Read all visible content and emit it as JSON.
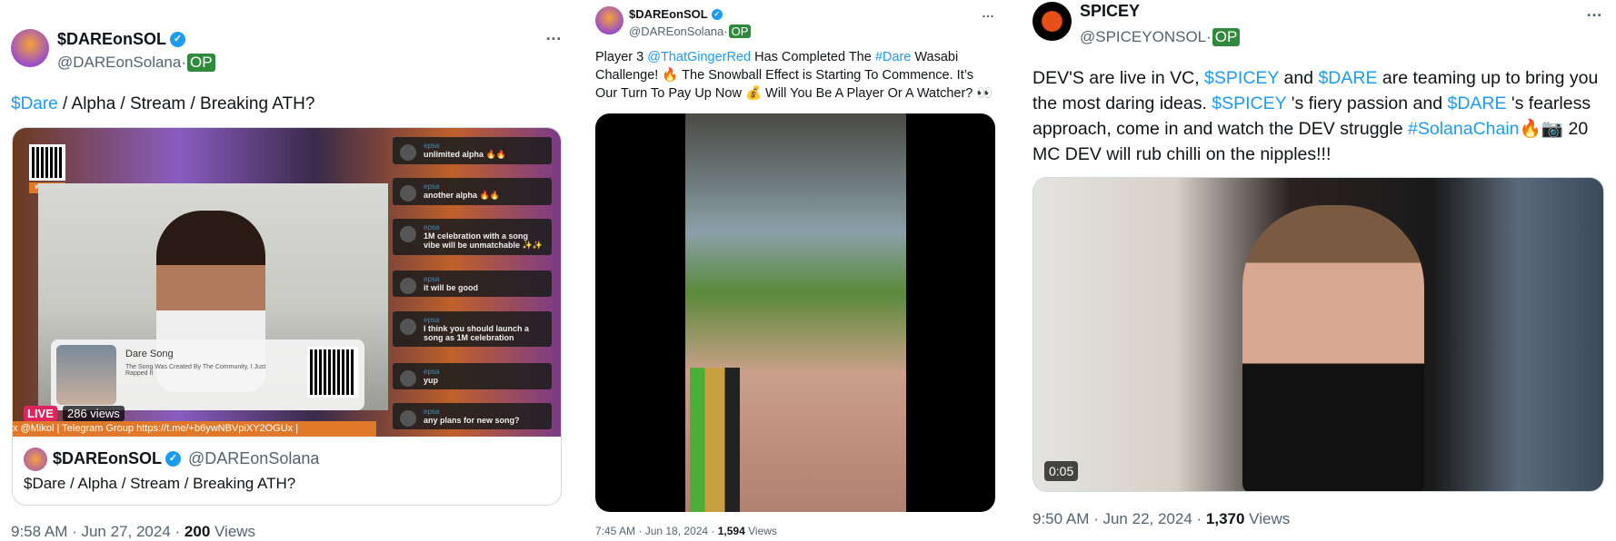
{
  "tweets": [
    {
      "name": "$DAREonSOL",
      "handle": "@DAREonSolana·",
      "op_badge": "OP",
      "text_parts": [
        "$Dare",
        " / Alpha / Stream / Breaking ATH?"
      ],
      "media": {
        "live_badge": "LIVE",
        "views_overlay": "286 views",
        "ticker": "x @Mikol | Telegram Group https://t.me/+b6ywNBVpiXY2OGUx |",
        "website_label": "WEBSITE",
        "song_title": "Dare Song",
        "song_desc": "The Song Was Created By The Community, I Just Rapped It",
        "chat": [
          {
            "user": "epsa",
            "msg": "unlimited alpha 🔥🔥"
          },
          {
            "user": "epsa",
            "msg": "another alpha 🔥🔥"
          },
          {
            "user": "epsa",
            "msg": "1M celebration with a song vibe will be unmatchable ✨✨"
          },
          {
            "user": "epsa",
            "msg": "it will be good"
          },
          {
            "user": "epsa",
            "msg": "I think you should launch a song as 1M celebration"
          },
          {
            "user": "epsa",
            "msg": "yup"
          },
          {
            "user": "epsa",
            "msg": "any plans for new song?"
          }
        ]
      },
      "quote": {
        "name": "$DAREonSOL",
        "handle": "@DAREonSolana",
        "text": "$Dare / Alpha / Stream / Breaking ATH?"
      },
      "time": "9:58 AM · Jun 27, 2024 · ",
      "views": "200",
      "views_label": " Views"
    },
    {
      "name": "$DAREonSOL",
      "handle": "@DAREonSolana·",
      "op_badge": "OP",
      "text_parts": [
        "Player 3 ",
        "@ThatGingerRed",
        " Has Completed The ",
        "#Dare",
        " Wasabi Challenge! 🔥 The Snowball Effect is Starting To Commence. It’s Our Turn To Pay Up Now 💰 Will You Be A Player Or A Watcher? 👀"
      ],
      "time": "7:45 AM · Jun 18, 2024 · ",
      "views": "1,594",
      "views_label": " Views"
    },
    {
      "name": "SPICEY",
      "handle": "@SPICEYONSOL·",
      "op_badge": "OP",
      "text_parts": [
        "DEV'S are live in VC, ",
        "$SPICEY",
        " and ",
        "$DARE",
        " are teaming up to bring you the most daring ideas.  ",
        "$SPICEY",
        " 's fiery passion and ",
        "$DARE",
        " 's fearless approach, come in and watch the DEV struggle ",
        "#SolanaChain",
        "🔥📷 20 MC DEV will rub chilli on the nipples!!!"
      ],
      "video_duration": "0:05",
      "time": "9:50 AM · Jun 22, 2024 · ",
      "views": "1,370",
      "views_label": " Views"
    }
  ],
  "more_icon": "…",
  "colors": {
    "link": "#1d9bf0",
    "op_badge": "#2f8a3b",
    "live": "#e0245e",
    "ticker": "#e07a2a"
  }
}
